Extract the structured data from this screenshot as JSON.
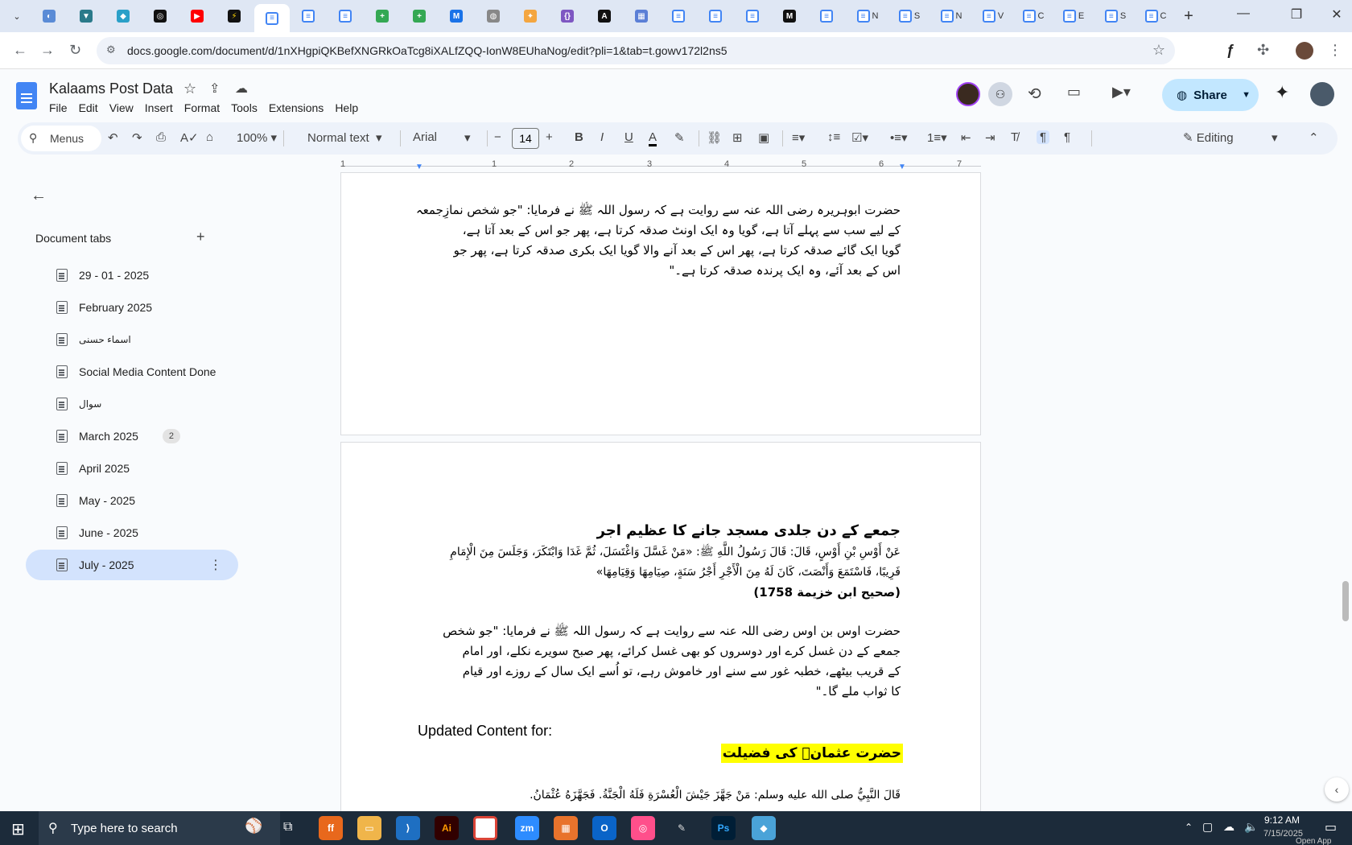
{
  "browser": {
    "url": "docs.google.com/document/d/1nXHgpiQKBefXNGRkOaTcg8iXALfZQQ-IonW8EUhaNog/edit?pli=1&tab=t.gowv172l2ns5",
    "tab_labels": [
      "N",
      "S",
      "N",
      "V",
      "C",
      "E",
      "S",
      "C"
    ]
  },
  "doc": {
    "title": "Kalaams Post Data",
    "menu": [
      "File",
      "Edit",
      "View",
      "Insert",
      "Format",
      "Tools",
      "Extensions",
      "Help"
    ],
    "share_label": "Share"
  },
  "toolbar": {
    "menus_label": "Menus",
    "zoom": "100%",
    "style": "Normal text",
    "font": "Arial",
    "font_size": "14",
    "mode": "Editing"
  },
  "ruler": [
    "1",
    "1",
    "2",
    "3",
    "4",
    "5",
    "6",
    "7"
  ],
  "sidebar": {
    "heading": "Document tabs",
    "tabs": [
      {
        "label": "29 - 01 - 2025"
      },
      {
        "label": "February 2025"
      },
      {
        "label": "اسماء حسنی"
      },
      {
        "label": "Social Media Content Done"
      },
      {
        "label": "سوال"
      },
      {
        "label": "March 2025",
        "badge": "2"
      },
      {
        "label": "April 2025"
      },
      {
        "label": "May - 2025"
      },
      {
        "label": "June - 2025"
      },
      {
        "label": "July - 2025"
      }
    ]
  },
  "page1": {
    "lines": [
      "حضرت ابوہریرہ رضی اللہ عنہ سے روایت ہے کہ رسول اللہ ﷺ نے فرمایا: \"جو شخص نمازِجمعہ",
      "کے لیے سب سے پہلے آتا ہے، گویا وہ ایک اونٹ صدقہ کرتا ہے، پھر جو اس کے بعد آتا ہے،",
      "گویا ایک گائے صدقہ کرتا ہے، پھر اس کے بعد آنے والا گویا ایک بکری صدقہ کرتا ہے، پھر جو",
      "اس کے بعد آئے، وہ ایک پرندہ صدقہ کرتا ہے۔\""
    ]
  },
  "page2": {
    "heading": "جمعے کے دن جلدی مسجد جانے کا عظیم اجر",
    "arabic": [
      "عَنْ أَوْسِ بْنِ أَوْسٍ، قَالَ: قَالَ رَسُولُ اللَّهِ ﷺ: «مَنْ غَسَّلَ وَاغْتَسَلَ، ثُمَّ غَدَا وَابْتَكَرَ، وَجَلَسَ مِنَ الْإِمَامِ",
      "فَرِيبًا، فَاسْتَمَعَ وَأَنْصَتَ، كَانَ لَهُ مِنَ الْأَجْرِ أَجْرُ سَنَةٍ، صِيَامِهَا وَقِيَامِهَا»",
      "(صحیح ابن خزیمة 1758)"
    ],
    "urdu": [
      "حضرت اوس بن اوس رضی اللہ عنہ سے روایت ہے کہ رسول اللہ ﷺ نے فرمایا: \"جو شخص",
      "جمعے کے دن غسل کرے اور دوسروں کو بھی غسل کرائے، پھر صبح سویرے نکلے، اور امام",
      "کے قریب بیٹھے، خطبہ غور سے سنے اور خاموش رہے، تو اُسے ایک سال کے روزے اور قیام",
      "کا ثواب ملے گا۔\""
    ],
    "updated_label": "Updated Content for:",
    "highlight": "حضرت عثمانؓ کی فضیلت",
    "last_line": "قَالَ النَّبِيُّ صلى الله عليه وسلم: مَنْ جَهَّزَ جَيْشَ الْعُسْرَةِ فَلَهُ الْجَنَّةُ. فَجَهَّزَهُ عُثْمَانُ."
  },
  "taskbar": {
    "search_placeholder": "Type here to search",
    "time": "9:12 AM",
    "date": "7/15/2025",
    "overflow_text": "Open App"
  },
  "colors": {
    "accent": "#4285f4",
    "share_bg": "#c2e7ff",
    "highlight": "#ffff00",
    "selected_tab": "#d3e3fd"
  }
}
